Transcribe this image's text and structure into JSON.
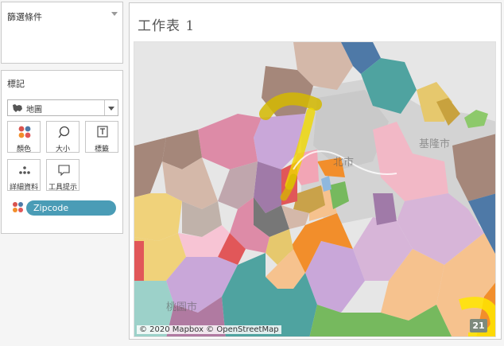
{
  "filters": {
    "title": "篩選條件"
  },
  "marks": {
    "title": "標記",
    "mark_type": "地圖",
    "cards": [
      {
        "label": "顏色",
        "icon": "color-dots-icon"
      },
      {
        "label": "大小",
        "icon": "size-icon"
      },
      {
        "label": "標籤",
        "icon": "label-icon"
      },
      {
        "label": "詳細資料",
        "icon": "detail-icon"
      },
      {
        "label": "工具提示",
        "icon": "tooltip-icon"
      }
    ],
    "field_pill": "Zipcode"
  },
  "sheet": {
    "title": "工作表 1",
    "map_labels": {
      "center": "北市",
      "east": "基隆市",
      "south": "桃園市"
    },
    "attribution": "© 2020 Mapbox © OpenStreetMap",
    "count_badge": "21"
  },
  "colors": {
    "pill": "#4a9cb6",
    "highlight": "#ffe600"
  }
}
